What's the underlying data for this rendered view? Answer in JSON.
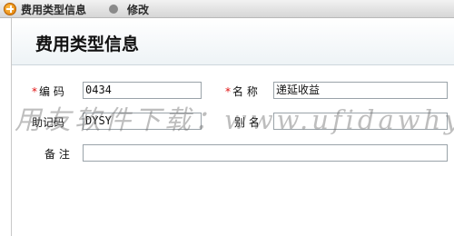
{
  "titlebar": {
    "title": "费用类型信息",
    "subtitle": "修改"
  },
  "header": {
    "page_title": "费用类型信息"
  },
  "form": {
    "code_label": "编 码",
    "code_value": "0434",
    "name_label": "名 称",
    "name_value": "递延收益",
    "mnemonic_label": "助记码",
    "mnemonic_value": "DYSY",
    "alias_label": "别 名",
    "alias_value": "",
    "remark_label": "备 注",
    "remark_value": "",
    "required_mark": "*"
  },
  "watermark": {
    "text": "用友软件下载：www.ufidawhy.com"
  },
  "colors": {
    "required": "#e01010",
    "field_border": "#9aa3a9",
    "header_bg": "#eef3f6"
  }
}
